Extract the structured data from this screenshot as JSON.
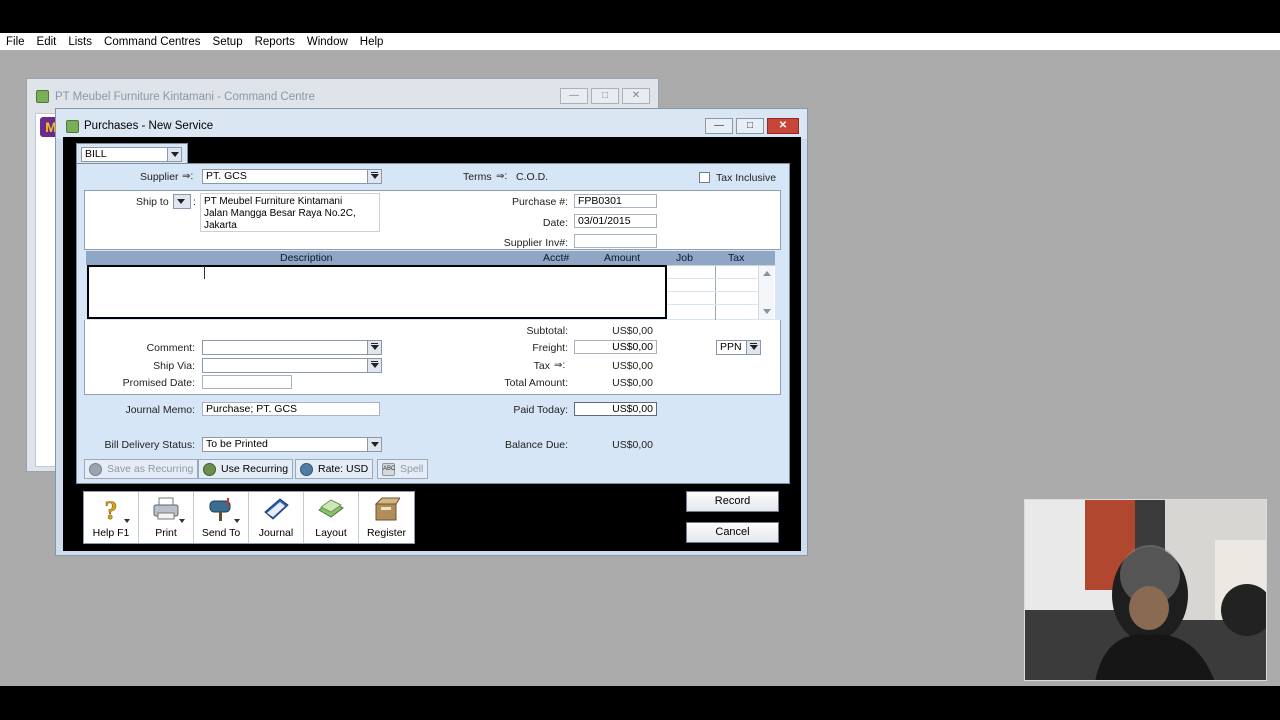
{
  "menubar": [
    "File",
    "Edit",
    "Lists",
    "Command Centres",
    "Setup",
    "Reports",
    "Window",
    "Help"
  ],
  "command_centre": {
    "title": "PT Meubel Furniture Kintamani - Command Centre",
    "logo_text": "M"
  },
  "purchases": {
    "title": "Purchases - New Service",
    "layout_type": "BILL",
    "supplier_label": "Supplier",
    "supplier_value": "PT. GCS",
    "terms_label": "Terms",
    "terms_value": "C.O.D.",
    "tax_inclusive_label": "Tax Inclusive",
    "ship_to_label": "Ship to",
    "ship_to_lines": [
      "PT Meubel Furniture Kintamani",
      "Jalan Mangga Besar Raya No.2C,",
      "Jakarta"
    ],
    "purchase_no_label": "Purchase #:",
    "purchase_no_value": "FPB0301",
    "date_label": "Date:",
    "date_value": "03/01/2015",
    "supplier_inv_label": "Supplier Inv#:",
    "supplier_inv_value": "",
    "columns": {
      "description": "Description",
      "acct": "Acct#",
      "amount": "Amount",
      "job": "Job",
      "tax": "Tax"
    },
    "subtotal_label": "Subtotal:",
    "subtotal_value": "US$0,00",
    "freight_label": "Freight:",
    "freight_value": "US$0,00",
    "tax_label": "Tax",
    "tax_value": "US$0,00",
    "tax_code": "PPN",
    "total_label": "Total Amount:",
    "total_value": "US$0,00",
    "comment_label": "Comment:",
    "ship_via_label": "Ship Via:",
    "promised_date_label": "Promised Date:",
    "journal_memo_label": "Journal Memo:",
    "journal_memo_value": "Purchase; PT. GCS",
    "paid_today_label": "Paid Today:",
    "paid_today_value": "US$0,00",
    "bill_delivery_label": "Bill Delivery Status:",
    "bill_delivery_value": "To be Printed",
    "balance_due_label": "Balance Due:",
    "balance_due_value": "US$0,00",
    "tools": {
      "save_recurring": "Save as Recurring",
      "use_recurring": "Use Recurring",
      "rate": "Rate:  USD",
      "spell": "Spell",
      "abc": "ABC"
    },
    "icons": [
      "Help F1",
      "Print",
      "Send To",
      "Journal",
      "Layout",
      "Register"
    ],
    "record_label": "Record",
    "cancel_label": "Cancel"
  },
  "colors": {
    "window_bg": "#cfdcec",
    "form_bg": "#d6e6f7",
    "table_header": "#8fa6c5",
    "close_button": "#c7463a"
  }
}
